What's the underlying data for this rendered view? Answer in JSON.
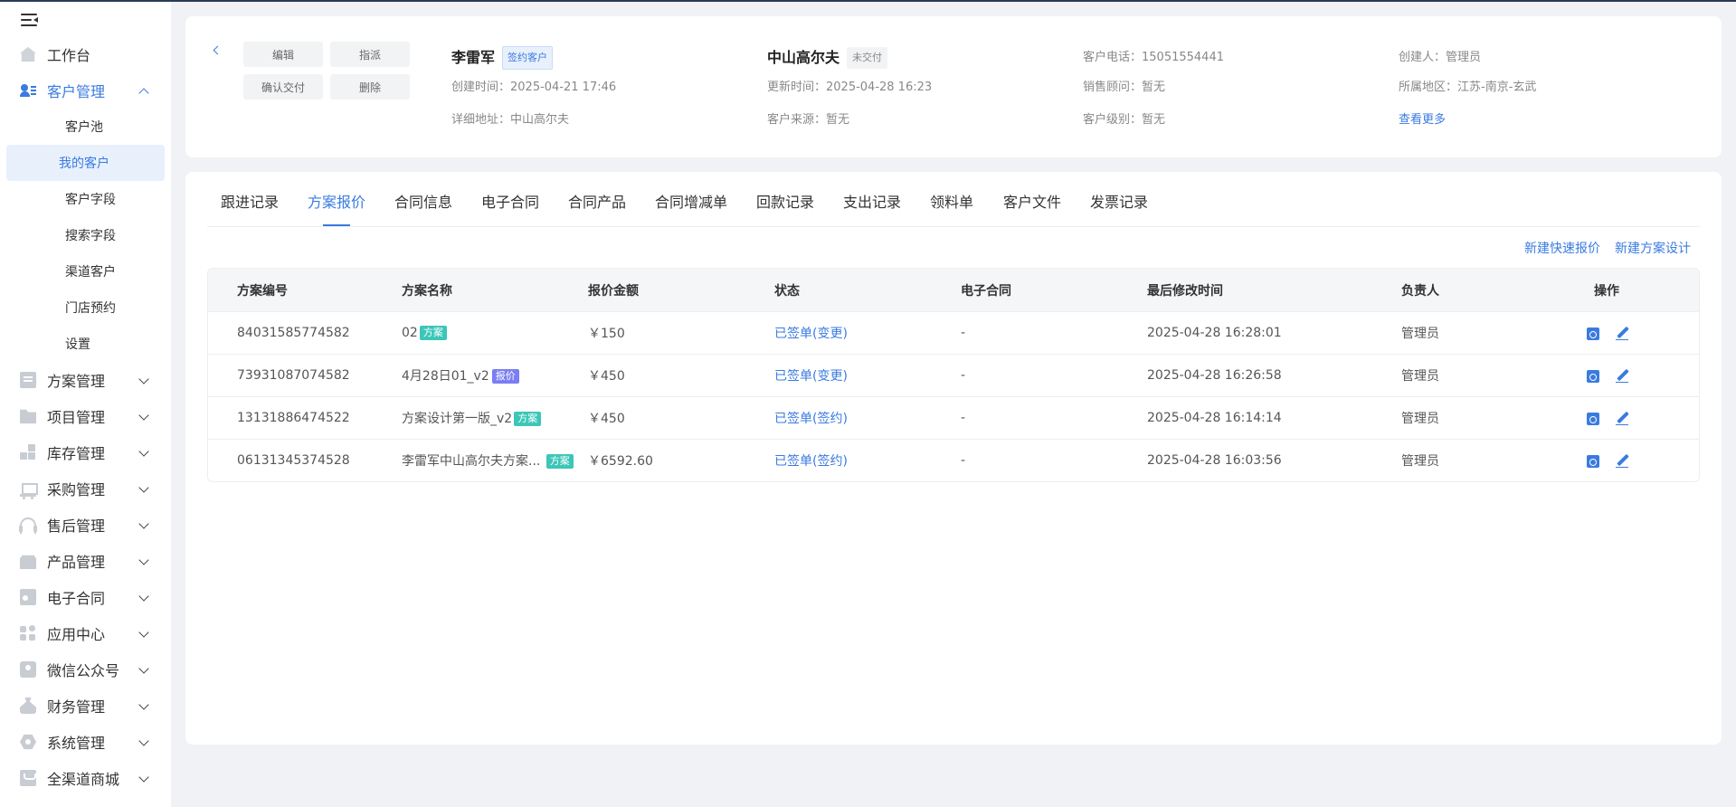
{
  "sidebar": {
    "items": [
      {
        "label": "工作台"
      },
      {
        "label": "客户管理"
      },
      {
        "label": "方案管理"
      },
      {
        "label": "项目管理"
      },
      {
        "label": "库存管理"
      },
      {
        "label": "采购管理"
      },
      {
        "label": "售后管理"
      },
      {
        "label": "产品管理"
      },
      {
        "label": "电子合同"
      },
      {
        "label": "应用中心"
      },
      {
        "label": "微信公众号"
      },
      {
        "label": "财务管理"
      },
      {
        "label": "系统管理"
      },
      {
        "label": "全渠道商城"
      }
    ],
    "sub_items": [
      {
        "label": "客户池"
      },
      {
        "label": "我的客户"
      },
      {
        "label": "客户字段"
      },
      {
        "label": "搜索字段"
      },
      {
        "label": "渠道客户"
      },
      {
        "label": "门店预约"
      },
      {
        "label": "设置"
      }
    ]
  },
  "header": {
    "buttons": {
      "edit": "编辑",
      "assign": "指派",
      "confirm_delivery": "确认交付",
      "delete": "删除"
    },
    "customer_name": "李雷军",
    "customer_tag": "签约客户",
    "created_time": "创建时间：2025-04-21 17:46",
    "address": "详细地址：中山高尔夫",
    "project_name": "中山高尔夫",
    "project_tag": "未交付",
    "updated_time": "更新时间：2025-04-28 16:23",
    "source": "客户来源：暂无",
    "phone": "客户电话：15051554441",
    "sales": "销售顾问：暂无",
    "level": "客户级别：暂无",
    "creator": "创建人：管理员",
    "region": "所属地区：江苏-南京-玄武",
    "more_link": "查看更多"
  },
  "tabs": [
    {
      "label": "跟进记录"
    },
    {
      "label": "方案报价"
    },
    {
      "label": "合同信息"
    },
    {
      "label": "电子合同"
    },
    {
      "label": "合同产品"
    },
    {
      "label": "合同增减单"
    },
    {
      "label": "回款记录"
    },
    {
      "label": "支出记录"
    },
    {
      "label": "领料单"
    },
    {
      "label": "客户文件"
    },
    {
      "label": "发票记录"
    }
  ],
  "actions": {
    "quick_quote": "新建快速报价",
    "plan_design": "新建方案设计"
  },
  "table": {
    "columns": [
      "方案编号",
      "方案名称",
      "报价金额",
      "状态",
      "电子合同",
      "最后修改时间",
      "负责人",
      "操作"
    ],
    "rows": [
      {
        "id": "84031585774582",
        "name": "02",
        "tag": "方案",
        "amount": "￥150",
        "status": "已签单(变更)",
        "contract": "-",
        "modified": "2025-04-28 16:28:01",
        "owner": "管理员"
      },
      {
        "id": "73931087074582",
        "name": "4月28日01_v2",
        "tag": "报价",
        "amount": "￥450",
        "status": "已签单(变更)",
        "contract": "-",
        "modified": "2025-04-28 16:26:58",
        "owner": "管理员"
      },
      {
        "id": "13131886474522",
        "name": "方案设计第一版_v2",
        "tag": "方案",
        "amount": "￥450",
        "status": "已签单(签约)",
        "contract": "-",
        "modified": "2025-04-28 16:14:14",
        "owner": "管理员"
      },
      {
        "id": "06131345374528",
        "name": "李雷军中山高尔夫方案...",
        "tag": "方案",
        "amount": "￥6592.60",
        "status": "已签单(签约)",
        "contract": "-",
        "modified": "2025-04-28 16:03:56",
        "owner": "管理员"
      }
    ]
  },
  "colors": {
    "accent": "#3a7be0",
    "tag_green": "#3cc6b8",
    "tag_purple": "#7b7ef2"
  }
}
